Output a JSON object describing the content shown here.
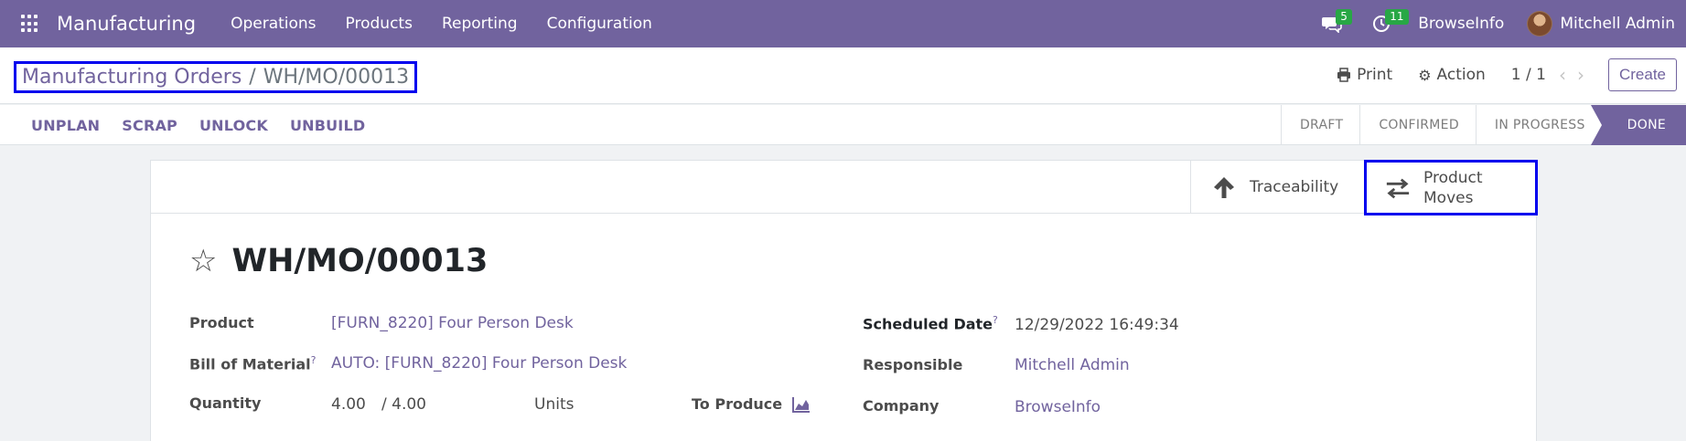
{
  "navbar": {
    "app_name": "Manufacturing",
    "menu": [
      "Operations",
      "Products",
      "Reporting",
      "Configuration"
    ],
    "messages_count": "5",
    "activities_count": "11",
    "company": "BrowseInfo",
    "user": "Mitchell Admin"
  },
  "control_panel": {
    "breadcrumb_parent": "Manufacturing Orders",
    "breadcrumb_sep": "/",
    "breadcrumb_current": "WH/MO/00013",
    "print_label": "Print",
    "action_label": "Action",
    "pager": "1 / 1",
    "create_label": "Create"
  },
  "statusbar": {
    "actions": [
      "UNPLAN",
      "SCRAP",
      "UNLOCK",
      "UNBUILD"
    ],
    "stages": [
      "DRAFT",
      "CONFIRMED",
      "IN PROGRESS",
      "DONE"
    ],
    "active_stage": "DONE"
  },
  "smart_buttons": {
    "traceability": "Traceability",
    "product_moves_line1": "Product",
    "product_moves_line2": "Moves"
  },
  "record": {
    "title": "WH/MO/00013",
    "product_label": "Product",
    "product_value": "[FURN_8220] Four Person Desk",
    "bom_label": "Bill of Material",
    "bom_help": "?",
    "bom_value": "AUTO: [FURN_8220] Four Person Desk",
    "quantity_label": "Quantity",
    "quantity_produced": "4.00",
    "quantity_total": "/ 4.00",
    "uom": "Units",
    "to_produce_label": "To Produce",
    "scheduled_label": "Scheduled Date",
    "scheduled_help": "?",
    "scheduled_value": "12/29/2022 16:49:34",
    "responsible_label": "Responsible",
    "responsible_value": "Mitchell Admin",
    "company_label": "Company",
    "company_value": "BrowseInfo"
  },
  "colors": {
    "brand": "#71639e",
    "badge": "#28a745",
    "highlight": "#0000ee"
  }
}
